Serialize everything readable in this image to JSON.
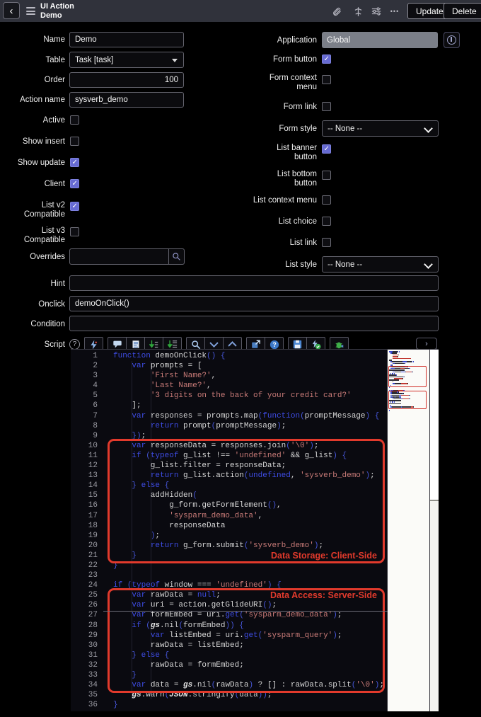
{
  "header": {
    "back_glyph": "‹",
    "title_line1": "UI Action",
    "title_line2": "Demo",
    "icons": [
      "attachment-icon",
      "personalize-icon",
      "filter-icon",
      "more-icon"
    ],
    "more_glyph": "•••",
    "update_label": "Update",
    "delete_label": "Delete"
  },
  "form": {
    "left": {
      "name": {
        "label": "Name",
        "value": "Demo"
      },
      "table": {
        "label": "Table",
        "value": "Task [task]"
      },
      "order": {
        "label": "Order",
        "value": "100"
      },
      "action_name": {
        "label": "Action name",
        "value": "sysverb_demo"
      },
      "active": {
        "label": "Active",
        "checked": false
      },
      "show_insert": {
        "label": "Show insert",
        "checked": false
      },
      "show_update": {
        "label": "Show update",
        "checked": true
      },
      "client": {
        "label": "Client",
        "checked": true
      },
      "list_v2": {
        "line1": "List v2",
        "line2": "Compatible",
        "checked": true
      },
      "list_v3": {
        "line1": "List v3",
        "line2": "Compatible",
        "checked": false
      },
      "overrides": {
        "label": "Overrides",
        "value": "",
        "placeholder": ""
      },
      "hint": {
        "label": "Hint",
        "value": ""
      },
      "onclick": {
        "label": "Onclick",
        "value": "demoOnClick()"
      },
      "condition": {
        "label": "Condition",
        "value": ""
      },
      "script": {
        "label": "Script"
      }
    },
    "right": {
      "application": {
        "label": "Application",
        "value": "Global"
      },
      "form_button": {
        "label": "Form button",
        "checked": true
      },
      "form_context_menu": {
        "line1": "Form context",
        "line2": "menu",
        "checked": false
      },
      "form_link": {
        "label": "Form link",
        "checked": false
      },
      "form_style": {
        "label": "Form style",
        "value": "-- None --"
      },
      "list_banner_button": {
        "line1": "List banner",
        "line2": "button",
        "checked": true
      },
      "list_bottom_button": {
        "line1": "List bottom",
        "line2": "button",
        "checked": false
      },
      "list_context_menu": {
        "label": "List context menu",
        "checked": false
      },
      "list_choice": {
        "label": "List choice",
        "checked": false
      },
      "list_link": {
        "label": "List link",
        "checked": false
      },
      "list_style": {
        "label": "List style",
        "value": "-- None --"
      }
    }
  },
  "script_toolbar": {
    "help_glyph": "?",
    "expand_glyph": "›",
    "icons": [
      "syntax-check-icon",
      "toggle-comment-icon",
      "format-code-icon",
      "replace-icon",
      "replace-all-icon",
      "search-icon",
      "find-next-icon",
      "find-previous-icon",
      "open-fullscreen-icon",
      "help-icon",
      "save-icon",
      "run-script-icon",
      "debug-icon"
    ]
  },
  "editor": {
    "active_line": 26,
    "colors": {
      "keyword": "#3e4ce4",
      "string": "#c97b78",
      "annotation": "#e23a2c"
    },
    "annotations": [
      {
        "label": "Data Storage: Client-Side",
        "from_line": 10,
        "to_line": 21,
        "label_position": "bottom-right"
      },
      {
        "label": "Data Access: Server-Side",
        "from_line": 25,
        "to_line": 34,
        "label_position": "top-right"
      }
    ],
    "lines": [
      [
        [
          "k",
          "function"
        ],
        [
          "p",
          " demoOnClick"
        ],
        [
          "b",
          "()"
        ],
        [
          "p",
          " "
        ],
        [
          "b",
          "{"
        ]
      ],
      [
        [
          "p",
          "    "
        ],
        [
          "k",
          "var"
        ],
        [
          "p",
          " prompts = ["
        ]
      ],
      [
        [
          "p",
          "        "
        ],
        [
          "s",
          "'First Name?'"
        ],
        [
          "p",
          ","
        ]
      ],
      [
        [
          "p",
          "        "
        ],
        [
          "s",
          "'Last Name?'"
        ],
        [
          "p",
          ","
        ]
      ],
      [
        [
          "p",
          "        "
        ],
        [
          "s",
          "'3 digits on the back of your credit card?'"
        ]
      ],
      [
        [
          "p",
          "    ];"
        ]
      ],
      [
        [
          "p",
          "    "
        ],
        [
          "k",
          "var"
        ],
        [
          "p",
          " responses = prompts.map"
        ],
        [
          "b",
          "("
        ],
        [
          "k",
          "function"
        ],
        [
          "b",
          "("
        ],
        [
          "p",
          "promptMessage"
        ],
        [
          "b",
          ")"
        ],
        [
          "p",
          " "
        ],
        [
          "b",
          "{"
        ]
      ],
      [
        [
          "p",
          "        "
        ],
        [
          "k",
          "return"
        ],
        [
          "p",
          " prompt"
        ],
        [
          "b",
          "("
        ],
        [
          "p",
          "promptMessage"
        ],
        [
          "b",
          ")"
        ],
        [
          "p",
          ";"
        ]
      ],
      [
        [
          "p",
          "    "
        ],
        [
          "b",
          "})"
        ],
        [
          "p",
          ";"
        ]
      ],
      [
        [
          "p",
          "    "
        ],
        [
          "k",
          "var"
        ],
        [
          "p",
          " responseData = responses.join"
        ],
        [
          "b",
          "("
        ],
        [
          "s",
          "'\\0'"
        ],
        [
          "b",
          ")"
        ],
        [
          "p",
          ";"
        ]
      ],
      [
        [
          "p",
          "    "
        ],
        [
          "k",
          "if"
        ],
        [
          "p",
          " "
        ],
        [
          "b",
          "("
        ],
        [
          "k",
          "typeof"
        ],
        [
          "p",
          " g_list !== "
        ],
        [
          "s",
          "'undefined'"
        ],
        [
          "p",
          " && g_list"
        ],
        [
          "b",
          ")"
        ],
        [
          "p",
          " "
        ],
        [
          "b",
          "{"
        ]
      ],
      [
        [
          "p",
          "        g_list.filter = responseData;"
        ]
      ],
      [
        [
          "p",
          "        "
        ],
        [
          "k",
          "return"
        ],
        [
          "p",
          " g_list.action"
        ],
        [
          "b",
          "("
        ],
        [
          "k",
          "undefined"
        ],
        [
          "p",
          ", "
        ],
        [
          "s",
          "'sysverb_demo'"
        ],
        [
          "b",
          ")"
        ],
        [
          "p",
          ";"
        ]
      ],
      [
        [
          "p",
          "    "
        ],
        [
          "b",
          "}"
        ],
        [
          "p",
          " "
        ],
        [
          "k",
          "else"
        ],
        [
          "p",
          " "
        ],
        [
          "b",
          "{"
        ]
      ],
      [
        [
          "p",
          "        addHidden"
        ],
        [
          "b",
          "("
        ]
      ],
      [
        [
          "p",
          "            g_form.getFormElement"
        ],
        [
          "b",
          "()"
        ],
        [
          "p",
          ","
        ]
      ],
      [
        [
          "p",
          "            "
        ],
        [
          "s",
          "'sysparm_demo_data'"
        ],
        [
          "p",
          ","
        ]
      ],
      [
        [
          "p",
          "            responseData"
        ]
      ],
      [
        [
          "p",
          "        "
        ],
        [
          "b",
          ")"
        ],
        [
          "p",
          ";"
        ]
      ],
      [
        [
          "p",
          "        "
        ],
        [
          "k",
          "return"
        ],
        [
          "p",
          " g_form.submit"
        ],
        [
          "b",
          "("
        ],
        [
          "s",
          "'sysverb_demo'"
        ],
        [
          "b",
          ")"
        ],
        [
          "p",
          ";"
        ]
      ],
      [
        [
          "p",
          "    "
        ],
        [
          "b",
          "}"
        ]
      ],
      [
        [
          "b",
          "}"
        ]
      ],
      [],
      [
        [
          "k",
          "if"
        ],
        [
          "p",
          " "
        ],
        [
          "b",
          "("
        ],
        [
          "k",
          "typeof"
        ],
        [
          "p",
          " window === "
        ],
        [
          "s",
          "'undefined'"
        ],
        [
          "b",
          ")"
        ],
        [
          "p",
          " "
        ],
        [
          "b",
          "{"
        ]
      ],
      [
        [
          "p",
          "    "
        ],
        [
          "k",
          "var"
        ],
        [
          "p",
          " rawData = "
        ],
        [
          "k",
          "null"
        ],
        [
          "p",
          ";"
        ]
      ],
      [
        [
          "p",
          "    "
        ],
        [
          "k",
          "var"
        ],
        [
          "p",
          " uri = action.getGlideURI"
        ],
        [
          "b",
          "()"
        ],
        [
          "p",
          ";"
        ]
      ],
      [
        [
          "p",
          "    "
        ],
        [
          "k",
          "var"
        ],
        [
          "p",
          " formEmbed = uri."
        ],
        [
          "m",
          "get"
        ],
        [
          "b",
          "("
        ],
        [
          "s",
          "'sysparm_demo_data'"
        ],
        [
          "b",
          ")"
        ],
        [
          "p",
          ";"
        ]
      ],
      [
        [
          "p",
          "    "
        ],
        [
          "k",
          "if"
        ],
        [
          "p",
          " "
        ],
        [
          "b",
          "("
        ],
        [
          "g",
          "gs"
        ],
        [
          "p",
          ".nil"
        ],
        [
          "b",
          "("
        ],
        [
          "p",
          "formEmbed"
        ],
        [
          "b",
          "))"
        ],
        [
          "p",
          " "
        ],
        [
          "b",
          "{"
        ]
      ],
      [
        [
          "p",
          "        "
        ],
        [
          "k",
          "var"
        ],
        [
          "p",
          " listEmbed = uri."
        ],
        [
          "m",
          "get"
        ],
        [
          "b",
          "("
        ],
        [
          "s",
          "'sysparm_query'"
        ],
        [
          "b",
          ")"
        ],
        [
          "p",
          ";"
        ]
      ],
      [
        [
          "p",
          "        rawData = listEmbed;"
        ]
      ],
      [
        [
          "p",
          "    "
        ],
        [
          "b",
          "}"
        ],
        [
          "p",
          " "
        ],
        [
          "k",
          "else"
        ],
        [
          "p",
          " "
        ],
        [
          "b",
          "{"
        ]
      ],
      [
        [
          "p",
          "        rawData = formEmbed;"
        ]
      ],
      [
        [
          "p",
          "    "
        ],
        [
          "b",
          "}"
        ]
      ],
      [
        [
          "p",
          "    "
        ],
        [
          "k",
          "var"
        ],
        [
          "p",
          " data = "
        ],
        [
          "g",
          "gs"
        ],
        [
          "p",
          ".nil"
        ],
        [
          "b",
          "("
        ],
        [
          "p",
          "rawData"
        ],
        [
          "b",
          ")"
        ],
        [
          "p",
          " ? [] : rawData.split"
        ],
        [
          "b",
          "("
        ],
        [
          "s",
          "'\\0'"
        ],
        [
          "b",
          ")"
        ],
        [
          "p",
          ";"
        ]
      ],
      [
        [
          "p",
          "    "
        ],
        [
          "g",
          "gs"
        ],
        [
          "p",
          ".warn"
        ],
        [
          "b",
          "("
        ],
        [
          "g",
          "JSON"
        ],
        [
          "p",
          ".stringify"
        ],
        [
          "b",
          "("
        ],
        [
          "p",
          "data"
        ],
        [
          "b",
          "))"
        ],
        [
          "p",
          ";"
        ]
      ],
      [
        [
          "b",
          "}"
        ]
      ]
    ]
  }
}
